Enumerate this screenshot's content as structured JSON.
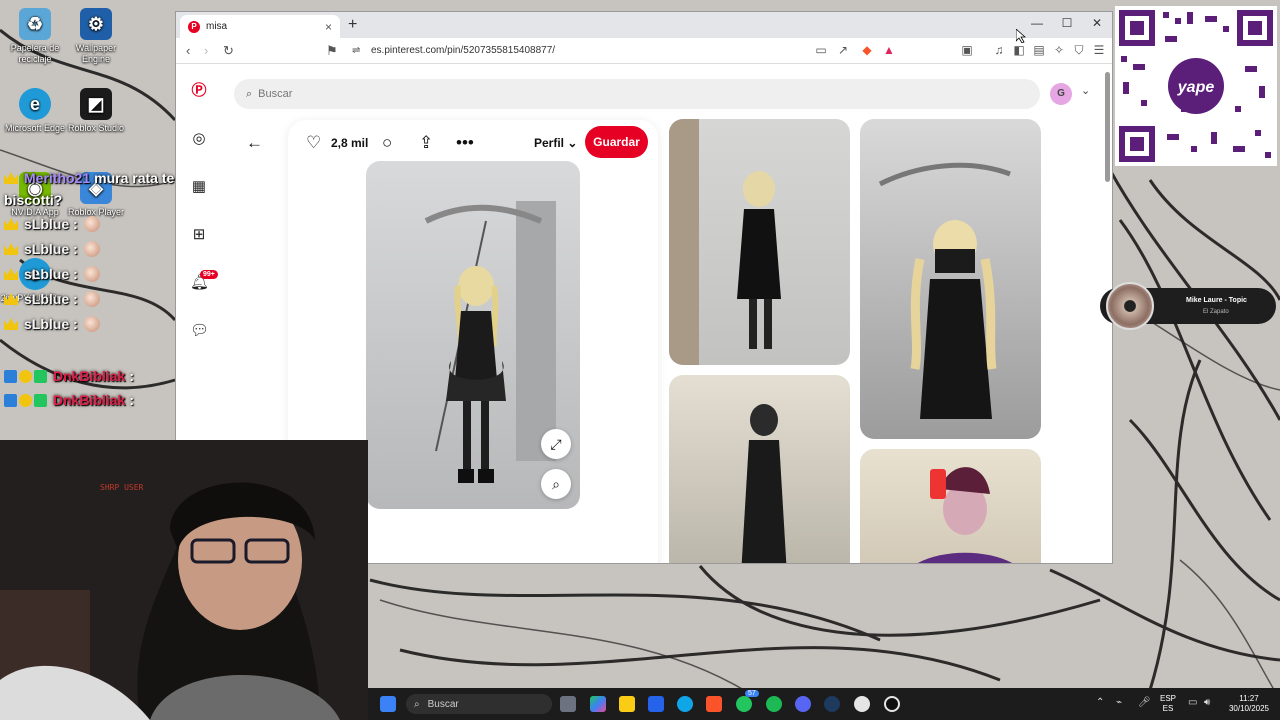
{
  "desktop": {
    "icons": [
      {
        "label": "Papelera de reciclaje",
        "icon": "recycle-bin-icon",
        "color": "#5aa6d6"
      },
      {
        "label": "Wallpaper Engine",
        "icon": "wallpaper-engine-icon",
        "color": "#1f5fa8"
      },
      {
        "label": "Microsoft Edge",
        "icon": "edge-icon",
        "color": "#1f9ad6"
      },
      {
        "label": "Roblox Studio",
        "icon": "roblox-studio-icon",
        "color": "#1b1b1b"
      },
      {
        "label": "NVIDIA App",
        "icon": "nvidia-icon",
        "color": "#76b900"
      },
      {
        "label": "Roblox Player",
        "icon": "roblox-player-icon",
        "color": "#3a86d8"
      },
      {
        "label": "2inyPY2UyH8ri...",
        "icon": "edge-shortcut-icon",
        "color": "#1f9ad6"
      }
    ]
  },
  "chat": {
    "messages": [
      {
        "user": "Meritho21",
        "text": "mura rata te veo mas blanca.. que paso usas el filtro de lia",
        "user_color": "#a78bfa"
      },
      {
        "continuation": "biscotti?"
      },
      {
        "user": "sLblue",
        "text": ":",
        "user_color": "#f5f5f5"
      },
      {
        "user": "sLblue",
        "text": ":",
        "user_color": "#f5f5f5"
      },
      {
        "user": "sLblue",
        "text": ":",
        "user_color": "#f5f5f5"
      },
      {
        "user": "sLblue",
        "text": ":",
        "user_color": "#f5f5f5"
      },
      {
        "user": "sLblue",
        "text": ":",
        "user_color": "#f5f5f5"
      },
      {
        "user": "DnkBibliak",
        "text": ":",
        "user_color": "#e11d48"
      },
      {
        "user": "DnkBibliak",
        "text": ":",
        "user_color": "#e11d48"
      }
    ]
  },
  "webcam": {
    "sign": "SHRP USER"
  },
  "browser": {
    "tab_title": "misa",
    "url": "es.pinterest.com/pin/5207355815408877/",
    "window_controls": [
      "minimize-icon",
      "maximize-icon",
      "close-icon"
    ]
  },
  "pinterest": {
    "search_placeholder": "Buscar",
    "avatar_initial": "G",
    "likes": "2,8 mil",
    "profile_label": "Perfil",
    "save_label": "Guardar",
    "notification_badge": "99+",
    "accent": "#e60023"
  },
  "media": {
    "title": "Mike Laure - Topic",
    "subtitle": "El Zapato"
  },
  "taskbar": {
    "search_placeholder": "Buscar",
    "whatsapp_badge": "57",
    "lang_top": "ESP",
    "lang_bottom": "ES",
    "time": "11:27",
    "date": "30/10/2025"
  }
}
